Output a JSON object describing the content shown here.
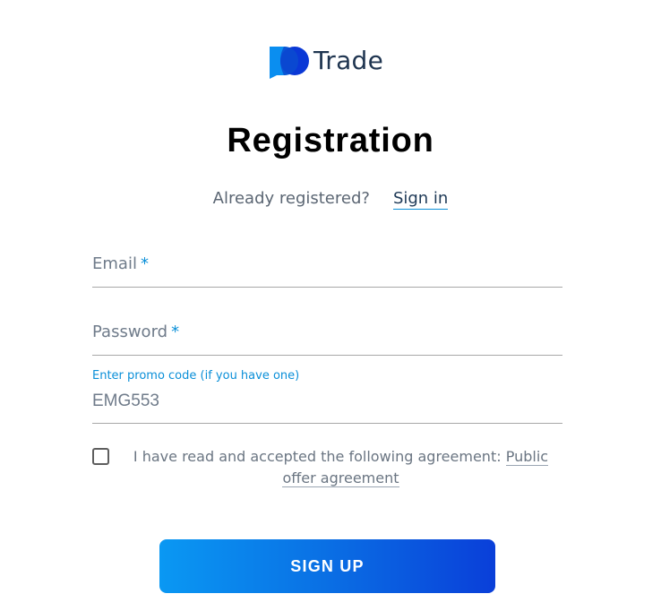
{
  "logo": {
    "text": "Trade"
  },
  "page": {
    "title": "Registration"
  },
  "signin": {
    "prompt": "Already registered?",
    "link": "Sign in"
  },
  "form": {
    "email": {
      "placeholder": "Email",
      "required_mark": "*"
    },
    "password": {
      "placeholder": "Password",
      "required_mark": "*"
    },
    "promo": {
      "label": "Enter promo code (if you have one)",
      "value": "EMG553"
    },
    "agreement": {
      "checked": false,
      "text": "I have read and accepted the following agreement:",
      "link": "Public offer agreement"
    },
    "submit_label": "SIGN UP"
  },
  "colors": {
    "accent": "#0a8fd8",
    "button_gradient_start": "#0a98f3",
    "button_gradient_end": "#0a3fd9"
  }
}
